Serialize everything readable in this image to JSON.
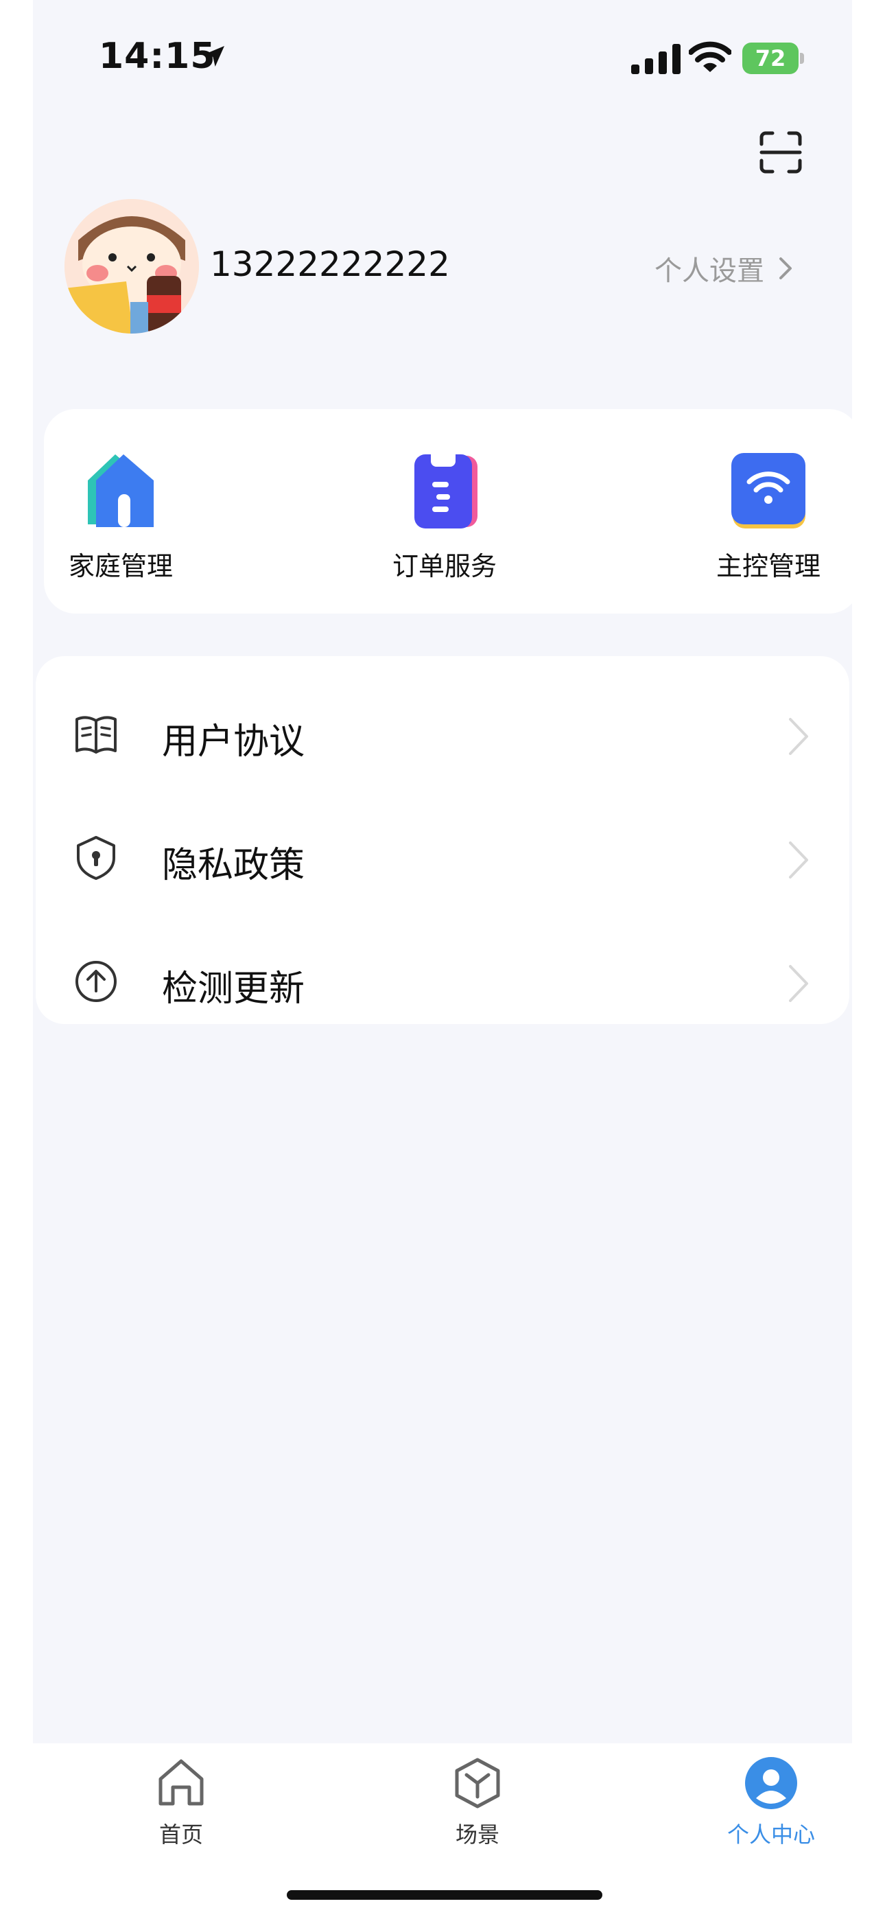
{
  "status_bar": {
    "time": "14:15",
    "battery": "72"
  },
  "profile": {
    "phone": "13222222222",
    "settings_label": "个人设置"
  },
  "quick_actions": [
    {
      "label": "家庭管理",
      "icon": "home-manage-icon"
    },
    {
      "label": "订单服务",
      "icon": "order-clipboard-icon"
    },
    {
      "label": "主控管理",
      "icon": "wifi-hub-icon"
    }
  ],
  "menu": [
    {
      "label": "用户协议",
      "icon": "book-icon"
    },
    {
      "label": "隐私政策",
      "icon": "shield-icon"
    },
    {
      "label": "检测更新",
      "icon": "upload-arrow-icon"
    }
  ],
  "tabs": [
    {
      "label": "首页",
      "icon": "home-icon",
      "active": false
    },
    {
      "label": "场景",
      "icon": "cube-icon",
      "active": false
    },
    {
      "label": "个人中心",
      "icon": "user-icon",
      "active": true
    }
  ],
  "colors": {
    "accent": "#3a8ee6",
    "background": "#f5f6fb",
    "battery": "#5ec65e"
  }
}
